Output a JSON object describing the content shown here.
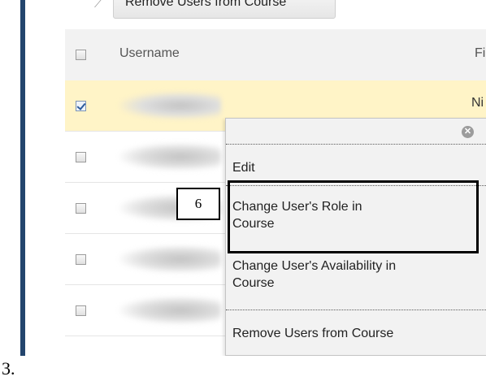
{
  "toolbar": {
    "remove_label": "Remove Users from Course"
  },
  "table": {
    "columns": {
      "username": "Username",
      "first": "Fir"
    },
    "selected_first_partial": "Ni",
    "rows": [
      {
        "checked": true
      },
      {
        "checked": false
      },
      {
        "checked": false
      },
      {
        "checked": false
      },
      {
        "checked": false
      }
    ]
  },
  "context_menu": {
    "close_glyph": "✕",
    "items": [
      {
        "label": "Edit"
      },
      {
        "label": "Change User's Role in Course"
      },
      {
        "label": "Change User's Availability in Course"
      },
      {
        "label": "Remove Users from Course"
      }
    ]
  },
  "annotation": {
    "callout_number": "6"
  },
  "step": {
    "label": "3."
  },
  "colors": {
    "accent_rule": "#23456d",
    "selected_row": "#fff4c7",
    "menu_bg": "#f2f2f2"
  }
}
